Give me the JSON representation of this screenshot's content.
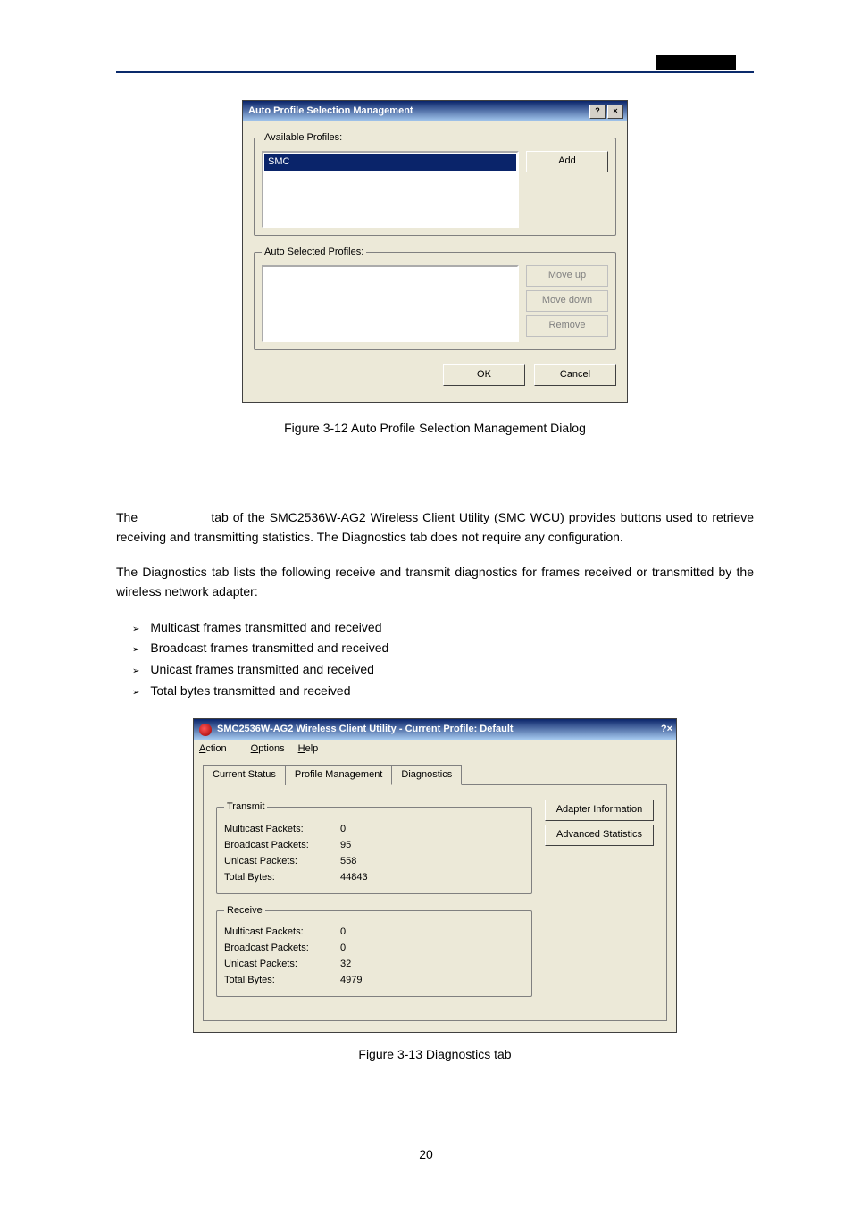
{
  "top_rule": true,
  "dialog1": {
    "title": "Auto Profile Selection Management",
    "help_btn": "?",
    "close_btn": "×",
    "available_legend": "Available Profiles:",
    "available_items": [
      "SMC"
    ],
    "add_btn": "Add",
    "auto_legend": "Auto Selected Profiles:",
    "moveup_btn": "Move up",
    "movedown_btn": "Move down",
    "remove_btn": "Remove",
    "ok_btn": "OK",
    "cancel_btn": "Cancel"
  },
  "caption1": "Figure 3-12 Auto Profile Selection Management Dialog",
  "section_label_prefix": "The ",
  "section_label_suffix": " tab of the SMC2536W-AG2 Wireless Client Utility (SMC WCU) provides buttons used to retrieve receiving and transmitting statistics. The Diagnostics tab does not require any configuration.",
  "para2": "The Diagnostics tab lists the following receive and transmit diagnostics for frames received or transmitted by the wireless network adapter:",
  "bullets": [
    "Multicast frames transmitted and received",
    "Broadcast frames transmitted and received",
    "Unicast frames transmitted and received",
    "Total bytes transmitted and received"
  ],
  "dialog2": {
    "title": "SMC2536W-AG2 Wireless Client Utility - Current Profile: Default",
    "help_btn": "?",
    "close_btn": "×",
    "menu": {
      "action": "Action",
      "options": "Options",
      "help": "Help"
    },
    "tabs": {
      "t1": "Current Status",
      "t2": "Profile Management",
      "t3": "Diagnostics"
    },
    "transmit_legend": "Transmit",
    "receive_legend": "Receive",
    "fields": {
      "multicast": "Multicast Packets:",
      "broadcast": "Broadcast Packets:",
      "unicast": "Unicast Packets:",
      "total": "Total Bytes:"
    },
    "transmit": {
      "multicast": "0",
      "broadcast": "95",
      "unicast": "558",
      "total": "44843"
    },
    "receive": {
      "multicast": "0",
      "broadcast": "0",
      "unicast": "32",
      "total": "4979"
    },
    "adapter_btn": "Adapter Information",
    "adv_btn": "Advanced Statistics"
  },
  "caption2": "Figure 3-13 Diagnostics tab",
  "page_number": "20"
}
